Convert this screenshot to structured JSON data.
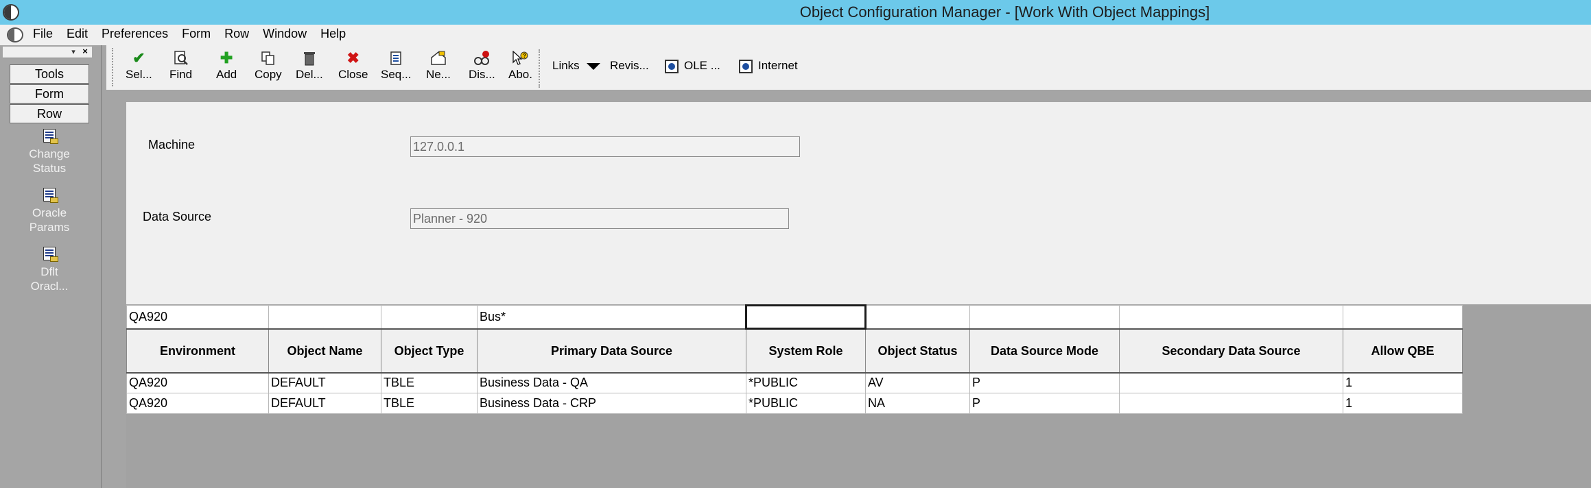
{
  "window": {
    "title": "Object Configuration Manager - [Work With Object Mappings]"
  },
  "menu": [
    "File",
    "Edit",
    "Preferences",
    "Form",
    "Row",
    "Window",
    "Help"
  ],
  "sidebar": {
    "tabs": [
      "Tools",
      "Form",
      "Row"
    ],
    "row_exits": [
      {
        "line1": "Change",
        "line2": "Status"
      },
      {
        "line1": "Oracle",
        "line2": "Params"
      },
      {
        "line1": "Dflt",
        "line2": "Oracl..."
      }
    ]
  },
  "toolbar": {
    "buttons": [
      {
        "label": "Sel...",
        "icon": "checkmark-icon",
        "color": "#1a8a1a"
      },
      {
        "label": "Find",
        "icon": "find-icon",
        "color": "#333333"
      },
      {
        "label": "Add",
        "icon": "plus-icon",
        "color": "#21a121"
      },
      {
        "label": "Copy",
        "icon": "copy-icon",
        "color": "#333333"
      },
      {
        "label": "Del...",
        "icon": "trash-icon",
        "color": "#333333"
      },
      {
        "label": "Close",
        "icon": "close-icon",
        "color": "#d01515"
      },
      {
        "label": "Seq...",
        "icon": "sequence-icon",
        "color": "#1d4ea0"
      },
      {
        "label": "Ne...",
        "icon": "new-icon",
        "color": "#333333"
      },
      {
        "label": "Dis...",
        "icon": "display-icon",
        "color": "#cc1111"
      },
      {
        "label": "Abo.",
        "icon": "about-icon",
        "color": "#333333"
      }
    ],
    "links_label": "Links",
    "revis_label": "Revis...",
    "ole_label": "OLE ...",
    "internet_label": "Internet"
  },
  "form": {
    "machine_label": "Machine",
    "machine_value": "127.0.0.1",
    "datasource_label": "Data Source",
    "datasource_value": "Planner - 920"
  },
  "grid": {
    "qbe": [
      "QA920",
      "",
      "",
      "Bus*",
      "",
      "",
      "",
      "",
      ""
    ],
    "headers": [
      "Environment",
      "Object Name",
      "Object Type",
      "Primary Data Source",
      "System Role",
      "Object Status",
      "Data Source Mode",
      "Secondary Data Source",
      "Allow QBE"
    ],
    "rows": [
      [
        "QA920",
        "DEFAULT",
        "TBLE",
        "Business Data - QA",
        "*PUBLIC",
        "AV",
        "P",
        "",
        "1"
      ],
      [
        "QA920",
        "DEFAULT",
        "TBLE",
        "Business Data - CRP",
        "*PUBLIC",
        "NA",
        "P",
        "",
        "1"
      ]
    ]
  }
}
